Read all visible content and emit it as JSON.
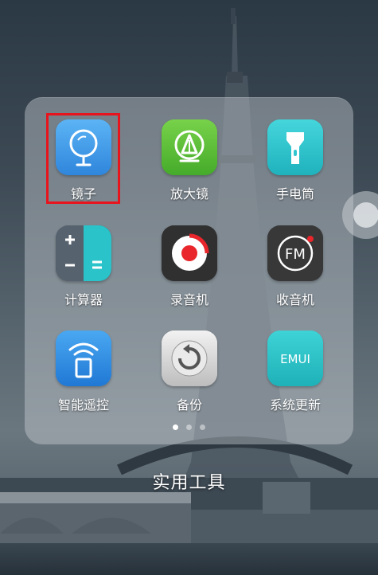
{
  "folder": {
    "title": "实用工具",
    "apps": [
      {
        "label": "镜子",
        "icon": "mirror-icon",
        "color": "#3f9be8"
      },
      {
        "label": "放大镜",
        "icon": "magnifier-icon",
        "color": "#5ec237"
      },
      {
        "label": "手电筒",
        "icon": "flashlight-icon",
        "color": "#30c6cf"
      },
      {
        "label": "计算器",
        "icon": "calculator-icon",
        "color": "#4a5a6a"
      },
      {
        "label": "录音机",
        "icon": "recorder-icon",
        "color": "#2e2e2e"
      },
      {
        "label": "收音机",
        "icon": "radio-fm-icon",
        "color": "#3a3a3a"
      },
      {
        "label": "智能遥控",
        "icon": "remote-control-icon",
        "color": "#2f8de0"
      },
      {
        "label": "备份",
        "icon": "backup-icon",
        "color": "#d8d8d8"
      },
      {
        "label": "系统更新",
        "icon": "emui-update-icon",
        "color": "#2ec4c8"
      }
    ],
    "page_indicator": {
      "pages": 3,
      "current": 1
    },
    "highlighted_app": "镜子",
    "highlight_color": "#e8141d"
  },
  "icons": {
    "radio_text": "FM",
    "update_text": "EMUI"
  }
}
